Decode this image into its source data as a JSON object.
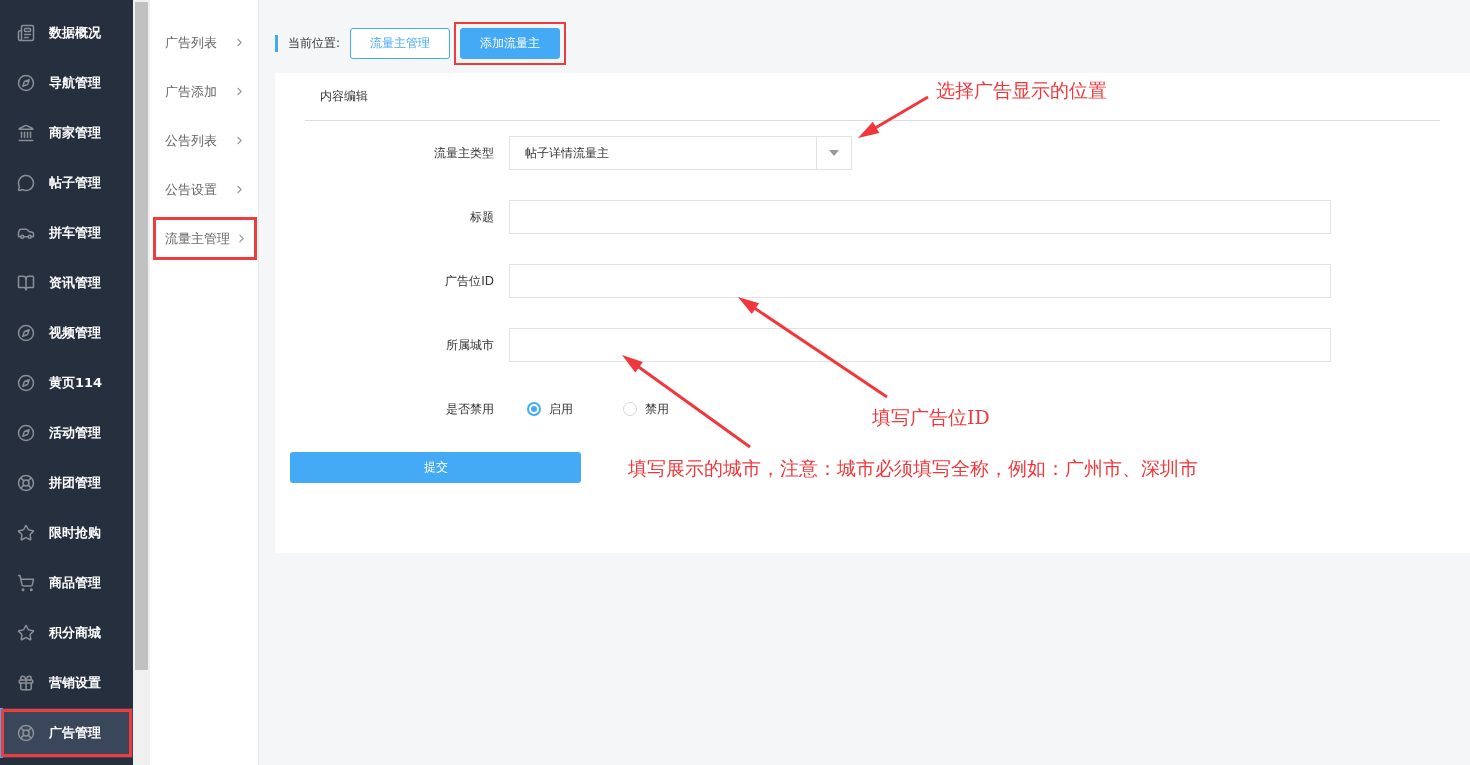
{
  "sidebar": {
    "items": [
      {
        "label": "数据概况",
        "selected": false,
        "highlighted": false
      },
      {
        "label": "导航管理",
        "selected": false,
        "highlighted": false
      },
      {
        "label": "商家管理",
        "selected": false,
        "highlighted": false
      },
      {
        "label": "帖子管理",
        "selected": false,
        "highlighted": false
      },
      {
        "label": "拼车管理",
        "selected": false,
        "highlighted": false
      },
      {
        "label": "资讯管理",
        "selected": false,
        "highlighted": false
      },
      {
        "label": "视频管理",
        "selected": false,
        "highlighted": false
      },
      {
        "label": "黄页114",
        "selected": false,
        "highlighted": false
      },
      {
        "label": "活动管理",
        "selected": false,
        "highlighted": false
      },
      {
        "label": "拼团管理",
        "selected": false,
        "highlighted": false
      },
      {
        "label": "限时抢购",
        "selected": false,
        "highlighted": false
      },
      {
        "label": "商品管理",
        "selected": false,
        "highlighted": false
      },
      {
        "label": "积分商城",
        "selected": false,
        "highlighted": false
      },
      {
        "label": "营销设置",
        "selected": false,
        "highlighted": false
      },
      {
        "label": "广告管理",
        "selected": true,
        "highlighted": true
      }
    ]
  },
  "submenu": {
    "items": [
      {
        "label": "广告列表",
        "highlighted": false
      },
      {
        "label": "广告添加",
        "highlighted": false
      },
      {
        "label": "公告列表",
        "highlighted": false
      },
      {
        "label": "公告设置",
        "highlighted": false
      },
      {
        "label": "流量主管理",
        "highlighted": true
      }
    ]
  },
  "breadcrumb": {
    "label": "当前位置:",
    "items": [
      {
        "label": "流量主管理",
        "selected": false,
        "highlighted": false
      },
      {
        "label": "添加流量主",
        "selected": true,
        "highlighted": true
      }
    ]
  },
  "form": {
    "section_title": "内容编辑",
    "fields": [
      {
        "kind": "select",
        "label": "流量主类型",
        "value": "帖子详情流量主"
      },
      {
        "kind": "text",
        "label": "标题"
      },
      {
        "kind": "text",
        "label": "广告位ID"
      },
      {
        "kind": "text",
        "label": "所属城市"
      },
      {
        "kind": "radio",
        "label": "是否禁用",
        "options": [
          {
            "label": "启用",
            "selected": true
          },
          {
            "label": "禁用",
            "selected": false
          }
        ]
      }
    ],
    "submit": "提交"
  },
  "annotations": [
    {
      "text": "选择广告显示的位置"
    },
    {
      "text": "填写广告位ID"
    },
    {
      "text": "填写展示的城市，注意：城市必须填写全称，例如：广州市、深圳市"
    }
  ]
}
